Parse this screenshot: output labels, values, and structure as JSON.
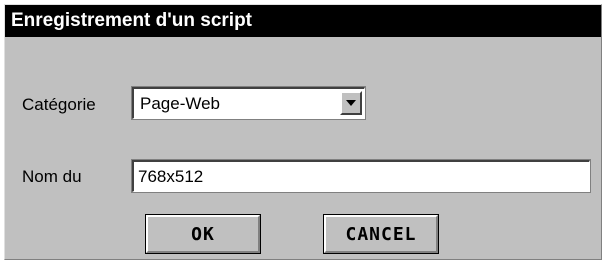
{
  "window": {
    "title": "Enregistrement d'un script"
  },
  "form": {
    "category_label": "Catégorie",
    "category_value": "Page-Web",
    "name_label": "Nom du",
    "name_value": "768x512"
  },
  "buttons": {
    "ok_label": "OK",
    "cancel_label": "CANCEL"
  },
  "icons": {
    "dropdown": "chevron-down-icon"
  }
}
